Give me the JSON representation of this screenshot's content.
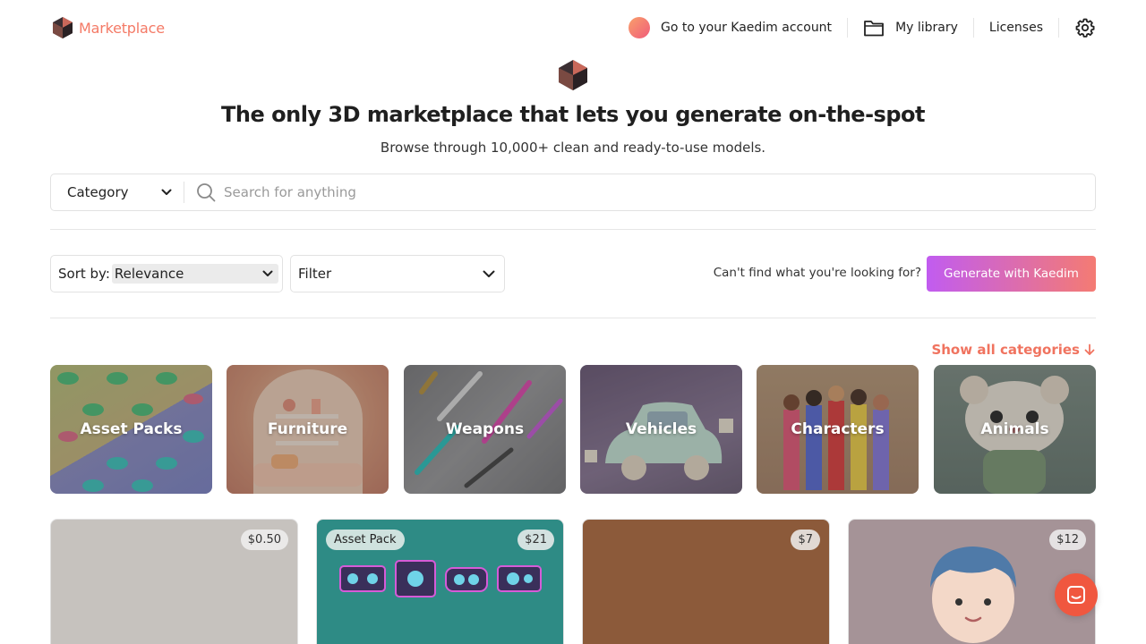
{
  "header": {
    "logo_text": "Marketplace",
    "nav": {
      "account_label": "Go to your Kaedim account",
      "library_label": "My library",
      "licenses_label": "Licenses"
    }
  },
  "hero": {
    "title": "The only 3D marketplace that lets you generate on-the-spot",
    "subtitle": "Browse through 10,000+ clean and ready-to-use models."
  },
  "search": {
    "category_label": "Category",
    "placeholder": "Search for anything"
  },
  "toolbar": {
    "sort_label": "Sort by:",
    "sort_value": "Relevance",
    "filter_label": "Filter",
    "cant_find_text": "Can't find what you're looking for?",
    "generate_label": "Generate with Kaedim"
  },
  "categories": {
    "show_all_label": "Show all categories",
    "items": [
      {
        "label": "Asset Packs"
      },
      {
        "label": "Furniture"
      },
      {
        "label": "Weapons"
      },
      {
        "label": "Vehicles"
      },
      {
        "label": "Characters"
      },
      {
        "label": "Animals"
      }
    ]
  },
  "products": [
    {
      "price": "$0.50",
      "badge": ""
    },
    {
      "price": "$21",
      "badge": "Asset Pack"
    },
    {
      "price": "$7",
      "badge": ""
    },
    {
      "price": "$12",
      "badge": ""
    }
  ],
  "colors": {
    "brand_coral": "#f47a66",
    "generate_gradient_start": "#c15cf0",
    "generate_gradient_end": "#f47b73",
    "chat_button": "#f0573f"
  }
}
